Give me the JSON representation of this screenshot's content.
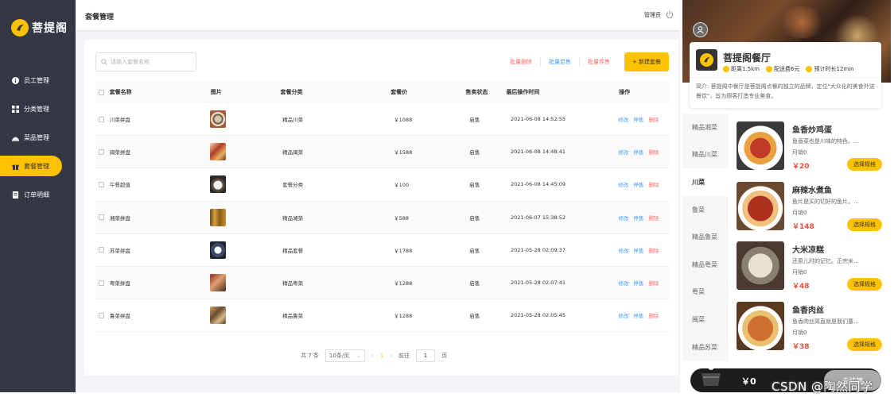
{
  "sidebar": {
    "brand": "菩提阁",
    "items": [
      {
        "label": "员工管理",
        "icon": "info-icon"
      },
      {
        "label": "分类管理",
        "icon": "grid-icon"
      },
      {
        "label": "菜品管理",
        "icon": "dish-icon"
      },
      {
        "label": "套餐管理",
        "icon": "gift-icon",
        "active": true
      },
      {
        "label": "订单明细",
        "icon": "order-icon"
      }
    ]
  },
  "topbar": {
    "title": "套餐管理",
    "user": "管理员"
  },
  "toolbar": {
    "search_placeholder": "请输入套餐名称",
    "batch_delete": "批量删除",
    "batch_enable": "批量启售",
    "batch_disable": "批量停售",
    "new_button": "+ 新建套餐"
  },
  "table": {
    "headers": [
      "套餐名称",
      "图片",
      "套餐分类",
      "套餐价",
      "售卖状态",
      "最后操作时间",
      "操作"
    ],
    "ops": {
      "edit": "修改",
      "stop": "停售",
      "delete": "删除"
    },
    "rows": [
      {
        "name": "川菜拼盘",
        "category": "精品川菜",
        "price": "￥1088",
        "status": "启售",
        "time": "2021-06-08 14:52:55"
      },
      {
        "name": "闽菜拼盘",
        "category": "精品闽菜",
        "price": "￥1588",
        "status": "启售",
        "time": "2021-06-08 14:48:41"
      },
      {
        "name": "午餐超值",
        "category": "套餐分类",
        "price": "￥100",
        "status": "启售",
        "time": "2021-06-08 14:45:09"
      },
      {
        "name": "湘菜拼盘",
        "category": "精品湘菜",
        "price": "￥588",
        "status": "启售",
        "time": "2021-06-07 15:38:52"
      },
      {
        "name": "苏菜拼盘",
        "category": "精品套餐",
        "price": "￥1788",
        "status": "启售",
        "time": "2021-05-28 02:09:37"
      },
      {
        "name": "粤菜拼盘",
        "category": "精品粤菜",
        "price": "￥1288",
        "status": "启售",
        "time": "2021-05-28 02:07:41"
      },
      {
        "name": "鲁菜拼盘",
        "category": "精品鲁菜",
        "price": "￥1288",
        "status": "启售",
        "time": "2021-05-28 02:05:45"
      }
    ]
  },
  "pager": {
    "total": "共 7 条",
    "page_size": "10条/页",
    "current": "1",
    "goto_prefix": "前往",
    "goto_value": "1",
    "goto_suffix": "页"
  },
  "mobile": {
    "shop_name": "菩提阁餐厅",
    "distance": "距离1.5km",
    "delivery_fee": "配送费6元",
    "eta": "预计时长12min",
    "description": "简介: 菩提阁中餐厅是菩提阁点餐的独立的品牌，定位\"大众化的美食外送餐饮\"，旨为顾客打造专业美食。",
    "categories": [
      "精品湘菜",
      "精品川菜",
      "川菜",
      "鲁菜",
      "精品鲁菜",
      "精品粤菜",
      "粤菜",
      "闽菜",
      "精品苏菜"
    ],
    "active_category_index": 2,
    "dishes": [
      {
        "name": "鱼香炒鸡蛋",
        "desc": "鱼香菜也是川味的特色。...",
        "sales": "月销0",
        "price": "￥20",
        "button": "选择规格"
      },
      {
        "name": "麻辣水煮鱼",
        "desc": "鱼片是买的切好的鱼片。...",
        "sales": "月销0",
        "price": "￥148",
        "button": "选择规格"
      },
      {
        "name": "大米凉糕",
        "desc": "还原儿时的记忆。正宗米...",
        "sales": "月销0",
        "price": "￥48",
        "button": "选择规格"
      },
      {
        "name": "鱼香肉丝",
        "desc": "鱼香肉丝简直就是我们童...",
        "sales": "月销0",
        "price": "￥38",
        "button": "选择规格"
      }
    ],
    "cart_total": "￥0",
    "checkout": "去结算"
  },
  "watermark": "CSDN @陶然同学",
  "colors": {
    "accent": "#ffc200",
    "sidebar": "#343744",
    "link": "#419eff",
    "danger": "#f56c6c",
    "price": "#e94e3c"
  }
}
